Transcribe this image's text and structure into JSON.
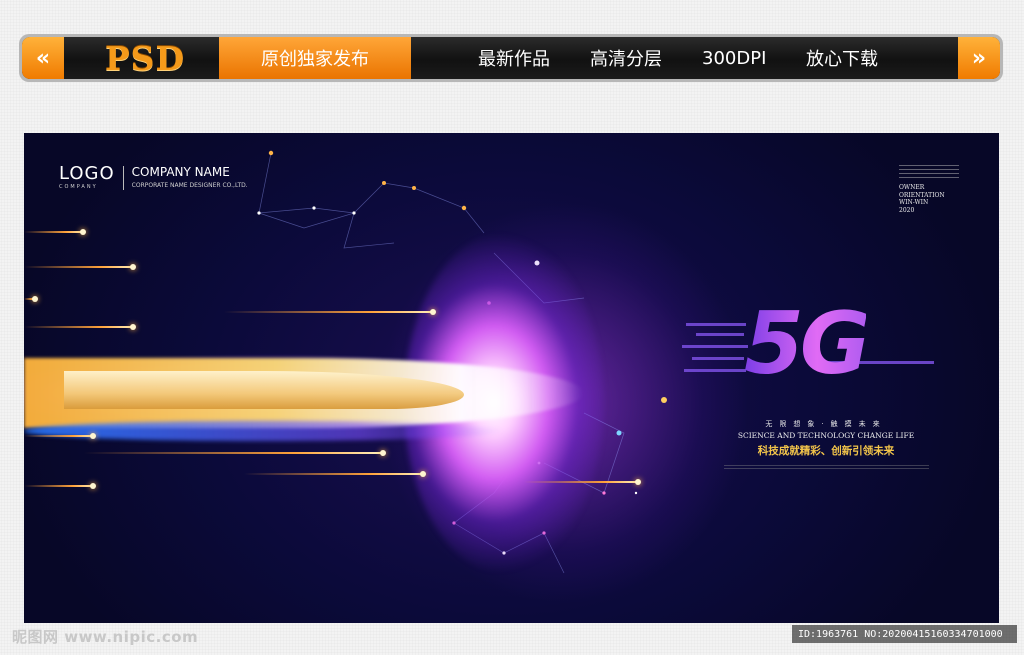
{
  "nav": {
    "prev_arrow": "«",
    "next_arrow": "»",
    "logo": "PSD",
    "active_tab": "原创独家发布",
    "items": [
      "最新作品",
      "高清分层",
      "300DPI",
      "放心下载"
    ]
  },
  "poster": {
    "logo_text": "LOGO",
    "logo_subtext": "COMPANY",
    "company_name": "COMPANY NAME",
    "company_subtitle": "CORPORATE NAME DESIGNER CO.,LTD.",
    "owner_lines": [
      "OWNER",
      "ORIENTATION",
      "WIN-WIN",
      "2020"
    ],
    "headline": "5G",
    "cn_tagline": "无限想象·触摸未来",
    "en_tagline": "SCIENCE AND TECHNOLOGY CHANGE LIFE",
    "slogan": "科技成就精彩、创新引领未来"
  },
  "watermark": {
    "site": "昵图网 www.nipic.com",
    "id_text": "ID:1963761 NO:20200415160334701000"
  },
  "colors": {
    "accent_orange": "#f08a10",
    "poster_bg": "#0b0a3a",
    "headline_purple": "#c25df4",
    "slogan_gold": "#f2c44a"
  },
  "icons": {
    "prev": "double-chevron-left-icon",
    "next": "double-chevron-right-icon"
  }
}
